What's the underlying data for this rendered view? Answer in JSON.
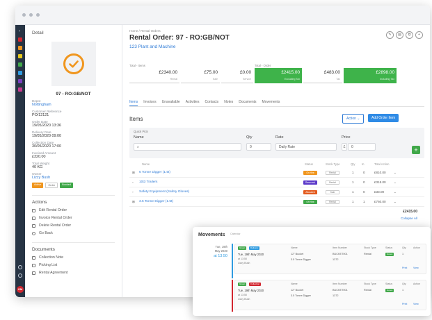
{
  "detail": {
    "title": "Detail",
    "order_code": "97 - RO:GB/NOT",
    "fields": [
      {
        "label": "Depot",
        "value": "Nottingham",
        "link": true
      },
      {
        "label": "Customer Reference",
        "value": "PO/12121",
        "link": false
      },
      {
        "label": "Order Date",
        "value": "19/05/2020 13:36",
        "link": false
      },
      {
        "label": "Delivery Date",
        "value": "19/05/2020 09:00",
        "link": false
      },
      {
        "label": "Collection Date",
        "value": "30/05/2020 17:00",
        "link": false
      },
      {
        "label": "Invoiced Amount",
        "value": "£320.00",
        "link": false
      },
      {
        "label": "Total Weight",
        "value": "40 KG",
        "link": false
      },
      {
        "label": "Owner",
        "value": "Lizzy Bush",
        "link": true
      }
    ],
    "badges": [
      {
        "label": "Active",
        "color": "#f0961e"
      },
      {
        "label": "Order",
        "color": "#ffffff"
      },
      {
        "label": "Booked",
        "color": "#41a84a"
      }
    ]
  },
  "actions": {
    "title": "Actions",
    "items": [
      "Edit Rental Order",
      "Invoice Rental Order",
      "Delete Rental Order",
      "Go Back"
    ]
  },
  "documents": {
    "title": "Documents",
    "items": [
      "Collection Note",
      "Picking List",
      "Rental Agreement"
    ]
  },
  "header": {
    "breadcrumb": "Home / Rental Orders",
    "title": "Rental Order: 97 - RO:GB/NOT",
    "customer": "123 Plant and Machine"
  },
  "totals": {
    "items_label": "Total - Items",
    "order_label": "Total - Order",
    "cells": [
      {
        "value": "£2340.00",
        "label": "Rental"
      },
      {
        "value": "£75.00",
        "label": "Sale"
      },
      {
        "value": "£0.00",
        "label": "Service"
      },
      {
        "value": "£2415.00",
        "label": "Excluding Tax"
      },
      {
        "value": "£483.00",
        "label": "Tax"
      },
      {
        "value": "£2898.00",
        "label": "Including Tax"
      }
    ]
  },
  "tabs": [
    "Items",
    "Invoices",
    "Unavailable",
    "Activities",
    "Contacts",
    "Notes",
    "Documents",
    "Movements"
  ],
  "items_section": {
    "heading": "Items",
    "action_label": "Action ⌄",
    "add_label": "Add Order Item"
  },
  "quick_pick": {
    "label": "Quick Pick",
    "name_label": "Name",
    "qty_label": "Qty",
    "rate_label": "Rate",
    "price_label": "Price",
    "qty_value": "0",
    "rate_value": "Daily Rate",
    "currency": "£",
    "price_value": "0"
  },
  "table": {
    "headers": [
      "Name",
      "Status",
      "Stock Type",
      "Qty",
      "In",
      "Total Action"
    ],
    "rows": [
      {
        "name": "6 Tonne Digger (1.5t)",
        "status": "On Hire",
        "status_color": "#f0961e",
        "stock": "Rental",
        "qty": "1",
        "in": "0",
        "total": "£810.00"
      },
      {
        "name": "10t3 Trailers",
        "status": "Reserved",
        "status_color": "#5b39c9",
        "stock": "Rental",
        "qty": "1",
        "in": "0",
        "total": "£315.00"
      },
      {
        "name": "Safety Equipment (Safety Gloves)",
        "status": "Allocated",
        "status_color": "#e35a1e",
        "stock": "Sale",
        "qty": "1",
        "in": "0",
        "total": "£33.00"
      },
      {
        "name": "3.5 Tonne Digger (1.5t)",
        "status": "Off Hire",
        "status_color": "#41a84a",
        "stock": "Rental",
        "qty": "1",
        "in": "1",
        "total": "£760.00"
      }
    ],
    "grand_total": "£2415.00",
    "collapse_label": "Collapse All"
  },
  "movements": {
    "title": "Movements",
    "subtitle": "Calendar",
    "date_line1": "Tue, 19th",
    "date_line2": "May 2020",
    "time": "at 13:50",
    "cols": [
      "Name",
      "Item Number",
      "Stock Type",
      "Status",
      "Qty",
      "Action"
    ],
    "cards": [
      {
        "tags": [
          {
            "label": "Green",
            "color": "#41a84a"
          },
          {
            "label": "Delivery",
            "color": "#2f9be0"
          }
        ],
        "date": "Tue, 19th May 2020",
        "sub1": "at 13:50",
        "sub2": "Lizzy Bush",
        "names": [
          "12\" Bucket",
          "3.5 Tonne Digger"
        ],
        "numbers": [
          "BUCKET001",
          "1372"
        ],
        "stock": "Rental",
        "status": "Green",
        "qty": "1",
        "links": [
          "Print",
          "View"
        ]
      },
      {
        "tags": [
          {
            "label": "Green",
            "color": "#41a84a"
          },
          {
            "label": "Collection",
            "color": "#d2262f"
          }
        ],
        "date": "Tue, 19th May 2020",
        "sub1": "at 13:50",
        "sub2": "Lizzy Bush",
        "names": [
          "12\" Bucket",
          "3.5 Tonne Digger"
        ],
        "numbers": [
          "BUCKET001",
          "1372"
        ],
        "stock": "Rental",
        "status": "Green",
        "qty": "1",
        "links": [
          "Print",
          "View"
        ]
      }
    ]
  }
}
